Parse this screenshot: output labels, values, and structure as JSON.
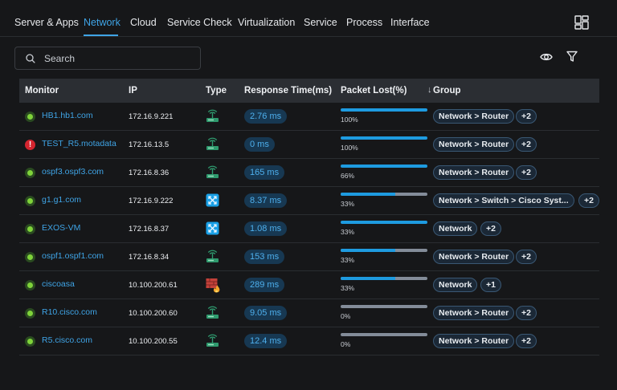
{
  "tabs": [
    {
      "label": "Server & Apps",
      "active": false
    },
    {
      "label": "Network",
      "active": true
    },
    {
      "label": "Cloud",
      "active": false
    },
    {
      "label": "Service Check",
      "active": false
    },
    {
      "label": "Virtualization",
      "active": false
    },
    {
      "label": "Service",
      "active": false
    },
    {
      "label": "Process",
      "active": false
    },
    {
      "label": "Interface",
      "active": false
    }
  ],
  "search": {
    "placeholder": "Search",
    "value": ""
  },
  "colors": {
    "accent": "#3fa4e6",
    "ok": "#7fd33a",
    "error": "#d4252f",
    "bar": "#1e9be0"
  },
  "table": {
    "headers": {
      "monitor": "Monitor",
      "ip": "IP",
      "type": "Type",
      "response_time": "Response Time(ms)",
      "packet_lost": "Packet Lost(%)",
      "group": "Group"
    },
    "sort": {
      "column": "packet_lost",
      "direction": "desc"
    },
    "rows": [
      {
        "status": "ok",
        "monitor": "HB1.hb1.com",
        "ip": "172.16.9.221",
        "type": "router-icon",
        "response_time": "2.76 ms",
        "packet_lost": 100,
        "packet_lost_label": "100%",
        "group": "Network > Router",
        "more": "+2"
      },
      {
        "status": "error",
        "monitor": "TEST_R5.motadata",
        "ip": "172.16.13.5",
        "type": "router-icon",
        "response_time": "0 ms",
        "packet_lost": 100,
        "packet_lost_label": "100%",
        "group": "Network > Router",
        "more": "+2"
      },
      {
        "status": "ok",
        "monitor": "ospf3.ospf3.com",
        "ip": "172.16.8.36",
        "type": "router-icon",
        "response_time": "165 ms",
        "packet_lost": 100,
        "packet_lost_label": "66%",
        "group": "Network > Router",
        "more": "+2"
      },
      {
        "status": "ok",
        "monitor": "g1.g1.com",
        "ip": "172.16.9.222",
        "type": "switch-icon",
        "response_time": "8.37 ms",
        "packet_lost": 63,
        "packet_lost_label": "33%",
        "group": "Network > Switch > Cisco Syst...",
        "more": "+2"
      },
      {
        "status": "ok",
        "monitor": "EXOS-VM",
        "ip": "172.16.8.37",
        "type": "switch-icon",
        "response_time": "1.08 ms",
        "packet_lost": 100,
        "packet_lost_label": "33%",
        "group": "Network",
        "more": "+2"
      },
      {
        "status": "ok",
        "monitor": "ospf1.ospf1.com",
        "ip": "172.16.8.34",
        "type": "router-icon",
        "response_time": "153 ms",
        "packet_lost": 63,
        "packet_lost_label": "33%",
        "group": "Network > Router",
        "more": "+2"
      },
      {
        "status": "ok",
        "monitor": "ciscoasa",
        "ip": "10.100.200.61",
        "type": "firewall-icon",
        "response_time": "289 ms",
        "packet_lost": 63,
        "packet_lost_label": "33%",
        "group": "Network",
        "more": "+1"
      },
      {
        "status": "ok",
        "monitor": "R10.cisco.com",
        "ip": "10.100.200.60",
        "type": "router-icon",
        "response_time": "9.05 ms",
        "packet_lost": 0,
        "packet_lost_label": "0%",
        "group": "Network > Router",
        "more": "+2"
      },
      {
        "status": "ok",
        "monitor": "R5.cisco.com",
        "ip": "10.100.200.55",
        "type": "router-icon",
        "response_time": "12.4 ms",
        "packet_lost": 0,
        "packet_lost_label": "0%",
        "group": "Network > Router",
        "more": "+2"
      }
    ]
  }
}
